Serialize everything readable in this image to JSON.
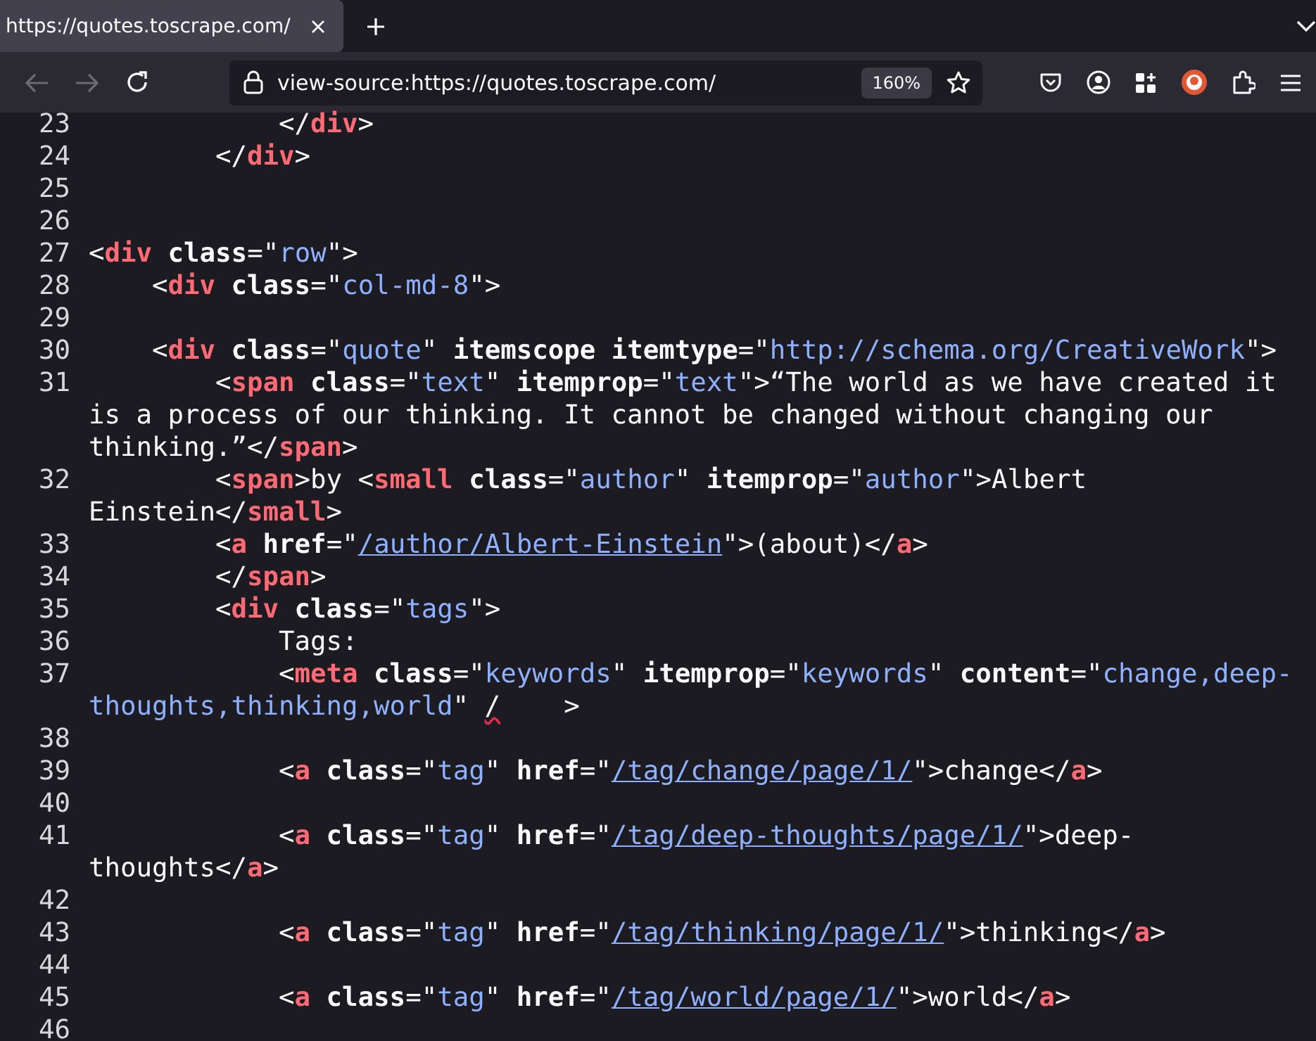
{
  "tab": {
    "title": "https://quotes.toscrape.com/",
    "selected": true
  },
  "nav_buttons": [
    {
      "kind": "back",
      "disabled": true
    },
    {
      "kind": "forward",
      "disabled": true
    },
    {
      "kind": "reload",
      "disabled": false
    }
  ],
  "address_bar": {
    "url": "view-source:https://quotes.toscrape.com/",
    "zoom": "160%"
  },
  "lines": [
    {
      "number": "23",
      "rows": [
        {
          "segments": [
            {
              "kind": "plain",
              "text": "            </"
            },
            {
              "kind": "tag",
              "text": "div"
            },
            {
              "kind": "plain",
              "text": ">"
            }
          ]
        }
      ]
    },
    {
      "number": "24",
      "rows": [
        {
          "segments": [
            {
              "kind": "plain",
              "text": "        </"
            },
            {
              "kind": "tag",
              "text": "div"
            },
            {
              "kind": "plain",
              "text": ">"
            }
          ]
        }
      ]
    },
    {
      "number": "25"
    },
    {
      "number": "26"
    },
    {
      "number": "27",
      "rows": [
        {
          "segments": [
            {
              "kind": "plain",
              "text": "<"
            },
            {
              "kind": "tag",
              "text": "div"
            },
            {
              "kind": "attr",
              "text": "class"
            },
            {
              "kind": "plain",
              "text": "=\""
            },
            {
              "kind": "value",
              "text": "row"
            },
            {
              "kind": "plain",
              "text": "\">"
            }
          ]
        }
      ]
    },
    {
      "number": "28",
      "rows": [
        {
          "segments": [
            {
              "kind": "plain",
              "text": "    <"
            },
            {
              "kind": "tag",
              "text": "div"
            },
            {
              "kind": "attr",
              "text": "class"
            },
            {
              "kind": "plain",
              "text": "=\""
            },
            {
              "kind": "value",
              "text": "col-md-8"
            },
            {
              "kind": "plain",
              "text": "\">"
            }
          ]
        }
      ]
    },
    {
      "number": "29"
    },
    {
      "number": "30",
      "rows": [
        {
          "segments": [
            {
              "kind": "plain",
              "text": "    <"
            },
            {
              "kind": "tag",
              "text": "div"
            },
            {
              "kind": "attr",
              "text": "class"
            },
            {
              "kind": "plain",
              "text": "=\""
            },
            {
              "kind": "value",
              "text": "quote"
            },
            {
              "kind": "plain",
              "text": "\" "
            },
            {
              "kind": "attr",
              "text": "itemscope"
            },
            {
              "kind": "attr",
              "text": "itemtype"
            },
            {
              "kind": "plain",
              "text": "=\""
            },
            {
              "kind": "value",
              "text": "http://schema.org/CreativeWork"
            },
            {
              "kind": "plain",
              "text": "\">"
            }
          ]
        }
      ]
    },
    {
      "number": "31",
      "rows": [
        {
          "segments": [
            {
              "kind": "plain",
              "text": "        <"
            },
            {
              "kind": "tag",
              "text": "span"
            },
            {
              "kind": "attr",
              "text": "class"
            },
            {
              "kind": "plain",
              "text": "=\""
            },
            {
              "kind": "value",
              "text": "text"
            },
            {
              "kind": "plain",
              "text": "\" "
            },
            {
              "kind": "attr",
              "text": "itemprop"
            },
            {
              "kind": "plain",
              "text": "=\""
            },
            {
              "kind": "value",
              "text": "text"
            },
            {
              "kind": "plain",
              "text": "\">“The world as we have created it"
            }
          ]
        },
        {
          "segments": [
            {
              "kind": "plain",
              "text": "is a process of our thinking. It cannot be changed without changing our"
            }
          ]
        },
        {
          "segments": [
            {
              "kind": "plain",
              "text": "thinking.”</"
            },
            {
              "kind": "tag",
              "text": "span"
            },
            {
              "kind": "plain",
              "text": ">"
            }
          ]
        }
      ]
    },
    {
      "number": "32",
      "rows": [
        {
          "segments": [
            {
              "kind": "plain",
              "text": "        <"
            },
            {
              "kind": "tag",
              "text": "span"
            },
            {
              "kind": "plain",
              "text": ">by <"
            },
            {
              "kind": "tag",
              "text": "small"
            },
            {
              "kind": "attr",
              "text": "class"
            },
            {
              "kind": "plain",
              "text": "=\""
            },
            {
              "kind": "value",
              "text": "author"
            },
            {
              "kind": "plain",
              "text": "\" "
            },
            {
              "kind": "attr",
              "text": "itemprop"
            },
            {
              "kind": "plain",
              "text": "=\""
            },
            {
              "kind": "value",
              "text": "author"
            },
            {
              "kind": "plain",
              "text": "\">Albert"
            }
          ]
        },
        {
          "segments": [
            {
              "kind": "plain",
              "text": "Einstein</"
            },
            {
              "kind": "tag",
              "text": "small"
            },
            {
              "kind": "plain",
              "text": ">"
            }
          ]
        }
      ]
    },
    {
      "number": "33",
      "rows": [
        {
          "segments": [
            {
              "kind": "plain",
              "text": "        <"
            },
            {
              "kind": "tag",
              "text": "a"
            },
            {
              "kind": "attr",
              "text": "href"
            },
            {
              "kind": "plain",
              "text": "=\""
            },
            {
              "kind": "link",
              "text": "/author/Albert-Einstein"
            },
            {
              "kind": "plain",
              "text": "\">(about)</"
            },
            {
              "kind": "tag",
              "text": "a"
            },
            {
              "kind": "plain",
              "text": ">"
            }
          ]
        }
      ]
    },
    {
      "number": "34",
      "rows": [
        {
          "segments": [
            {
              "kind": "plain",
              "text": "        </"
            },
            {
              "kind": "tag",
              "text": "span"
            },
            {
              "kind": "plain",
              "text": ">"
            }
          ]
        }
      ]
    },
    {
      "number": "35",
      "rows": [
        {
          "segments": [
            {
              "kind": "plain",
              "text": "        <"
            },
            {
              "kind": "tag",
              "text": "div"
            },
            {
              "kind": "attr",
              "text": "class"
            },
            {
              "kind": "plain",
              "text": "=\""
            },
            {
              "kind": "value",
              "text": "tags"
            },
            {
              "kind": "plain",
              "text": "\">"
            }
          ]
        }
      ]
    },
    {
      "number": "36",
      "rows": [
        {
          "segments": [
            {
              "kind": "plain",
              "text": "            Tags:"
            }
          ]
        }
      ]
    },
    {
      "number": "37",
      "rows": [
        {
          "segments": [
            {
              "kind": "plain",
              "text": "            <"
            },
            {
              "kind": "tag",
              "text": "meta"
            },
            {
              "kind": "attr",
              "text": "class"
            },
            {
              "kind": "plain",
              "text": "=\""
            },
            {
              "kind": "value",
              "text": "keywords"
            },
            {
              "kind": "plain",
              "text": "\" "
            },
            {
              "kind": "attr",
              "text": "itemprop"
            },
            {
              "kind": "plain",
              "text": "=\""
            },
            {
              "kind": "value",
              "text": "keywords"
            },
            {
              "kind": "plain",
              "text": "\" "
            },
            {
              "kind": "attr",
              "text": "content"
            },
            {
              "kind": "plain",
              "text": "=\""
            },
            {
              "kind": "value",
              "text": "change,deep-"
            }
          ]
        },
        {
          "segments": [
            {
              "kind": "value",
              "text": "thoughts,thinking,world"
            },
            {
              "kind": "plain",
              "text": "\" "
            },
            {
              "kind": "error",
              "text": "/"
            },
            {
              "kind": "plain",
              "text": "    >"
            }
          ]
        }
      ]
    },
    {
      "number": "38"
    },
    {
      "number": "39",
      "rows": [
        {
          "segments": [
            {
              "kind": "plain",
              "text": "            <"
            },
            {
              "kind": "tag",
              "text": "a"
            },
            {
              "kind": "attr",
              "text": "class"
            },
            {
              "kind": "plain",
              "text": "=\""
            },
            {
              "kind": "value",
              "text": "tag"
            },
            {
              "kind": "plain",
              "text": "\" "
            },
            {
              "kind": "attr",
              "text": "href"
            },
            {
              "kind": "plain",
              "text": "=\""
            },
            {
              "kind": "link",
              "text": "/tag/change/page/1/"
            },
            {
              "kind": "plain",
              "text": "\">change</"
            },
            {
              "kind": "tag",
              "text": "a"
            },
            {
              "kind": "plain",
              "text": ">"
            }
          ]
        }
      ]
    },
    {
      "number": "40"
    },
    {
      "number": "41",
      "rows": [
        {
          "segments": [
            {
              "kind": "plain",
              "text": "            <"
            },
            {
              "kind": "tag",
              "text": "a"
            },
            {
              "kind": "attr",
              "text": "class"
            },
            {
              "kind": "plain",
              "text": "=\""
            },
            {
              "kind": "value",
              "text": "tag"
            },
            {
              "kind": "plain",
              "text": "\" "
            },
            {
              "kind": "attr",
              "text": "href"
            },
            {
              "kind": "plain",
              "text": "=\""
            },
            {
              "kind": "link",
              "text": "/tag/deep-thoughts/page/1/"
            },
            {
              "kind": "plain",
              "text": "\">deep-"
            }
          ]
        },
        {
          "segments": [
            {
              "kind": "plain",
              "text": "thoughts</"
            },
            {
              "kind": "tag",
              "text": "a"
            },
            {
              "kind": "plain",
              "text": ">"
            }
          ]
        }
      ]
    },
    {
      "number": "42"
    },
    {
      "number": "43",
      "rows": [
        {
          "segments": [
            {
              "kind": "plain",
              "text": "            <"
            },
            {
              "kind": "tag",
              "text": "a"
            },
            {
              "kind": "attr",
              "text": "class"
            },
            {
              "kind": "plain",
              "text": "=\""
            },
            {
              "kind": "value",
              "text": "tag"
            },
            {
              "kind": "plain",
              "text": "\" "
            },
            {
              "kind": "attr",
              "text": "href"
            },
            {
              "kind": "plain",
              "text": "=\""
            },
            {
              "kind": "link",
              "text": "/tag/thinking/page/1/"
            },
            {
              "kind": "plain",
              "text": "\">thinking</"
            },
            {
              "kind": "tag",
              "text": "a"
            },
            {
              "kind": "plain",
              "text": ">"
            }
          ]
        }
      ]
    },
    {
      "number": "44"
    },
    {
      "number": "45",
      "rows": [
        {
          "segments": [
            {
              "kind": "plain",
              "text": "            <"
            },
            {
              "kind": "tag",
              "text": "a"
            },
            {
              "kind": "attr",
              "text": "class"
            },
            {
              "kind": "plain",
              "text": "=\""
            },
            {
              "kind": "value",
              "text": "tag"
            },
            {
              "kind": "plain",
              "text": "\" "
            },
            {
              "kind": "attr",
              "text": "href"
            },
            {
              "kind": "plain",
              "text": "=\""
            },
            {
              "kind": "link",
              "text": "/tag/world/page/1/"
            },
            {
              "kind": "plain",
              "text": "\">world</"
            },
            {
              "kind": "tag",
              "text": "a"
            },
            {
              "kind": "plain",
              "text": ">"
            }
          ]
        }
      ]
    },
    {
      "number": "46"
    }
  ]
}
